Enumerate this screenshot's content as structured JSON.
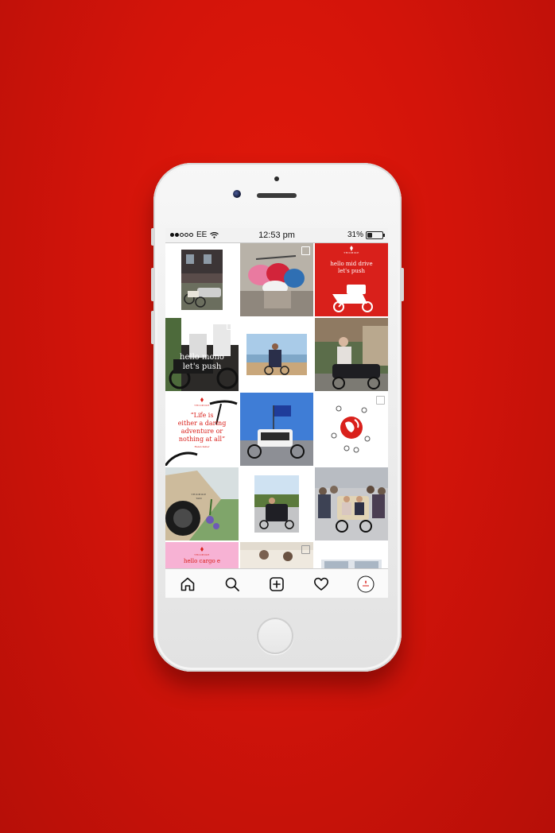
{
  "status_bar": {
    "carrier": "EE",
    "time": "12:53 pm",
    "battery": "31%",
    "battery_level": 0.31,
    "signal_dots_filled": 2,
    "signal_dots_total": 5
  },
  "posts": [
    {
      "kind": "photo",
      "desc": "house-with-bike"
    },
    {
      "kind": "photo",
      "desc": "helmets-in-cargo-box",
      "multi": true
    },
    {
      "kind": "brand",
      "brand": "TRIOBIKE",
      "text_lines": [
        "hello mid drive",
        "let's push"
      ]
    },
    {
      "kind": "photo",
      "text_lines": [
        "hello mono",
        "let's push"
      ],
      "multi": true
    },
    {
      "kind": "photo",
      "desc": "lakeside-ride"
    },
    {
      "kind": "photo",
      "desc": "woman-with-cargo-bike"
    },
    {
      "kind": "quote",
      "brand": "TRIOBIKE",
      "text_lines": [
        "“Life is",
        "either a daring",
        "adventure or",
        "nothing at all”"
      ],
      "author": "Helen Keller"
    },
    {
      "kind": "photo",
      "desc": "flag-on-cargo-bike"
    },
    {
      "kind": "brand",
      "desc": "globe-graphic",
      "multi": true
    },
    {
      "kind": "photo",
      "desc": "bike-in-grass",
      "brand": "TRIOBIKE",
      "sub": "TAXI"
    },
    {
      "kind": "photo",
      "desc": "rickshaw-park"
    },
    {
      "kind": "photo",
      "desc": "crowd-with-taxi"
    },
    {
      "kind": "brand",
      "brand": "TRIOBIKE",
      "text_lines": [
        "hello cargo e"
      ]
    },
    {
      "kind": "photo",
      "desc": "indoor",
      "multi": true
    },
    {
      "kind": "photo",
      "desc": "window"
    }
  ],
  "tabs": [
    {
      "name": "home"
    },
    {
      "name": "search"
    },
    {
      "name": "new-post"
    },
    {
      "name": "activity"
    },
    {
      "name": "profile"
    }
  ],
  "colors": {
    "background": "#d3140a",
    "brand_red": "#d9201b",
    "pink": "#f7b2d4"
  }
}
